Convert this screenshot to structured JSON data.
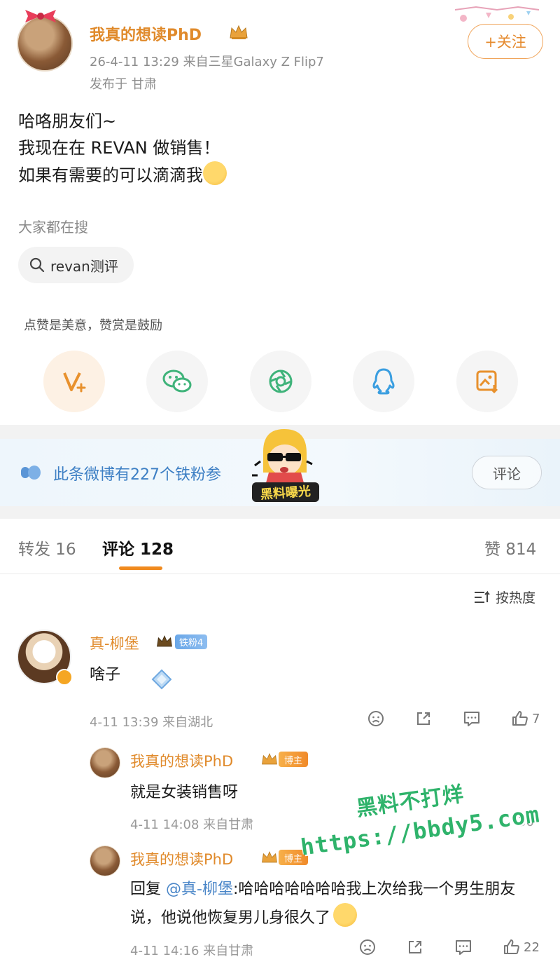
{
  "post": {
    "author": "我真的想读PhD",
    "meta": "26-4-11 13:29  来自三星Galaxy Z Flip7",
    "location": "发布于 甘肃",
    "follow_label": "+关注",
    "lines": [
      "哈咯朋友们~",
      "我现在在 REVAN 做销售！",
      "如果有需要的可以滴滴我"
    ]
  },
  "search": {
    "label": "大家都在搜",
    "chip": "revan测评"
  },
  "reward": {
    "tip": "点赞是美意，赞赏是鼓励"
  },
  "share_icons": [
    "reward-v-icon",
    "wechat-icon",
    "moments-icon",
    "qq-icon",
    "save-image-icon"
  ],
  "fan_banner": {
    "text": "此条微博有227个铁粉参",
    "button": "评论",
    "sticker_text": "黑料曝光"
  },
  "tabs": {
    "repost": "转发 16",
    "comment": "评论 128",
    "like": "赞 814"
  },
  "sort": {
    "label": "按热度"
  },
  "comments": [
    {
      "name": "真-柳堡",
      "fan_tag": "铁粉4",
      "text": "啥子",
      "meta": "4-11 13:39 来自湖北",
      "likes": "7",
      "replies": [
        {
          "name": "我真的想读PhD",
          "tag": "博主",
          "text": "就是女装销售呀",
          "meta": "4-11 14:08 来自甘肃",
          "likes": "30"
        },
        {
          "name": "我真的想读PhD",
          "tag": "博主",
          "reply_prefix": "回复",
          "mention": "@真-柳堡",
          "text": ":哈哈哈哈哈哈哈我上次给我一个男生朋友说，他说他恢复男儿身很久了",
          "meta": "4-11 14:16 来自甘肃",
          "likes": "22"
        }
      ]
    }
  ],
  "watermark": {
    "line1": "黑料不打烊",
    "line2": "https://bbdy5.com"
  },
  "colors": {
    "accent": "#e08a2b",
    "link": "#4a86c8",
    "watermark": "#2fb36b"
  }
}
